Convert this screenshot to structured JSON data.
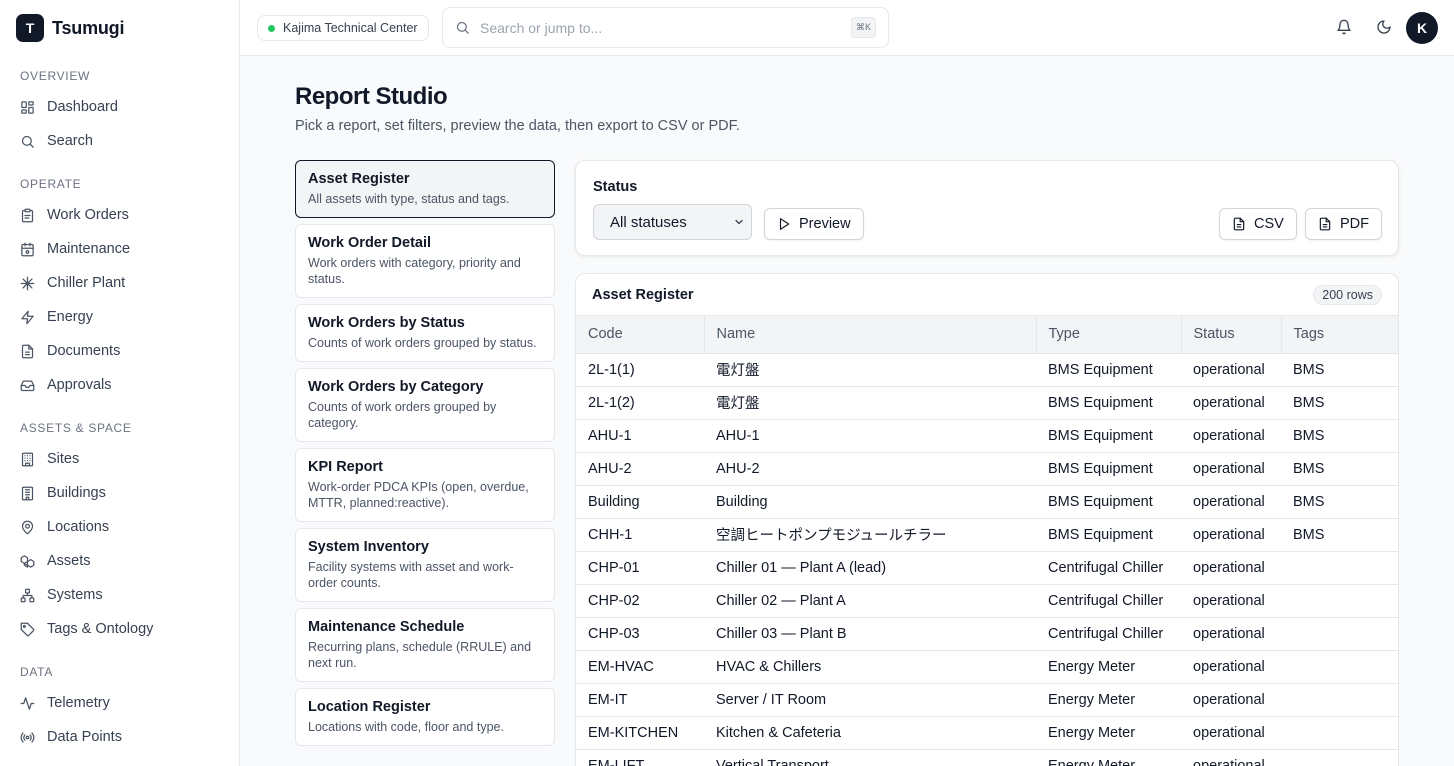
{
  "app": {
    "logo_letter": "T",
    "name": "Tsumugi"
  },
  "sidebar": {
    "sections": [
      {
        "heading": "OVERVIEW",
        "items": [
          {
            "label": "Dashboard",
            "icon": "dashboard-icon"
          },
          {
            "label": "Search",
            "icon": "search-icon"
          }
        ]
      },
      {
        "heading": "OPERATE",
        "items": [
          {
            "label": "Work Orders",
            "icon": "clipboard-icon"
          },
          {
            "label": "Maintenance",
            "icon": "calendar-wrench-icon"
          },
          {
            "label": "Chiller Plant",
            "icon": "snowflake-icon"
          },
          {
            "label": "Energy",
            "icon": "zap-icon"
          },
          {
            "label": "Documents",
            "icon": "document-icon"
          },
          {
            "label": "Approvals",
            "icon": "inbox-icon"
          }
        ]
      },
      {
        "heading": "ASSETS & SPACE",
        "items": [
          {
            "label": "Sites",
            "icon": "building-icon"
          },
          {
            "label": "Buildings",
            "icon": "office-icon"
          },
          {
            "label": "Locations",
            "icon": "map-pin-icon"
          },
          {
            "label": "Assets",
            "icon": "boxes-icon"
          },
          {
            "label": "Systems",
            "icon": "network-icon"
          },
          {
            "label": "Tags & Ontology",
            "icon": "tag-icon"
          }
        ]
      },
      {
        "heading": "DATA",
        "items": [
          {
            "label": "Telemetry",
            "icon": "activity-icon"
          },
          {
            "label": "Data Points",
            "icon": "radio-icon"
          }
        ]
      }
    ]
  },
  "topbar": {
    "site": "Kajima Technical Center",
    "search_placeholder": "Search or jump to...",
    "search_shortcut": "⌘K",
    "avatar_letter": "K"
  },
  "page": {
    "title": "Report Studio",
    "subtitle": "Pick a report, set filters, preview the data, then export to CSV or PDF."
  },
  "reports": [
    {
      "name": "Asset Register",
      "desc": "All assets with type, status and tags.",
      "active": true
    },
    {
      "name": "Work Order Detail",
      "desc": "Work orders with category, priority and status."
    },
    {
      "name": "Work Orders by Status",
      "desc": "Counts of work orders grouped by status."
    },
    {
      "name": "Work Orders by Category",
      "desc": "Counts of work orders grouped by category."
    },
    {
      "name": "KPI Report",
      "desc": "Work-order PDCA KPIs (open, overdue, MTTR, planned:reactive)."
    },
    {
      "name": "System Inventory",
      "desc": "Facility systems with asset and work-order counts."
    },
    {
      "name": "Maintenance Schedule",
      "desc": "Recurring plans, schedule (RRULE) and next run."
    },
    {
      "name": "Location Register",
      "desc": "Locations with code, floor and type."
    }
  ],
  "filters": {
    "status_label": "Status",
    "status_value": "All statuses",
    "preview_label": "Preview",
    "csv_label": "CSV",
    "pdf_label": "PDF"
  },
  "table": {
    "title": "Asset Register",
    "row_count": "200 rows",
    "columns": [
      "Code",
      "Name",
      "Type",
      "Status",
      "Tags"
    ],
    "rows": [
      [
        "2L-1(1)",
        "電灯盤",
        "BMS Equipment",
        "operational",
        "BMS"
      ],
      [
        "2L-1(2)",
        "電灯盤",
        "BMS Equipment",
        "operational",
        "BMS"
      ],
      [
        "AHU-1",
        "AHU-1",
        "BMS Equipment",
        "operational",
        "BMS"
      ],
      [
        "AHU-2",
        "AHU-2",
        "BMS Equipment",
        "operational",
        "BMS"
      ],
      [
        "Building",
        "Building",
        "BMS Equipment",
        "operational",
        "BMS"
      ],
      [
        "CHH-1",
        "空調ヒートポンプモジュールチラー",
        "BMS Equipment",
        "operational",
        "BMS"
      ],
      [
        "CHP-01",
        "Chiller 01 — Plant A (lead)",
        "Centrifugal Chiller",
        "operational",
        ""
      ],
      [
        "CHP-02",
        "Chiller 02 — Plant A",
        "Centrifugal Chiller",
        "operational",
        ""
      ],
      [
        "CHP-03",
        "Chiller 03 — Plant B",
        "Centrifugal Chiller",
        "operational",
        ""
      ],
      [
        "EM-HVAC",
        "HVAC & Chillers",
        "Energy Meter",
        "operational",
        ""
      ],
      [
        "EM-IT",
        "Server / IT Room",
        "Energy Meter",
        "operational",
        ""
      ],
      [
        "EM-KITCHEN",
        "Kitchen & Cafeteria",
        "Energy Meter",
        "operational",
        ""
      ],
      [
        "EM-LIFT",
        "Vertical Transport",
        "Energy Meter",
        "operational",
        ""
      ]
    ]
  }
}
